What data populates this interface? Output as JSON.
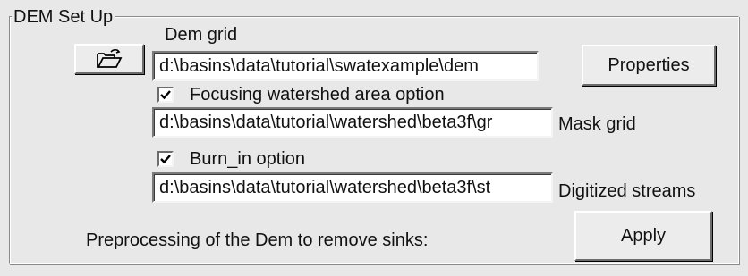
{
  "group": {
    "title": "DEM Set Up"
  },
  "dem": {
    "label": "Dem grid",
    "path": "d:\\basins\\data\\tutorial\\swatexample\\dem",
    "open_icon": "folder-open-icon",
    "properties_label": "Properties"
  },
  "focus": {
    "checked": true,
    "label": "Focusing watershed  area option",
    "path": "d:\\basins\\data\\tutorial\\watershed\\beta3f\\gr",
    "side_label": "Mask grid"
  },
  "burn": {
    "checked": true,
    "label": "Burn_in option",
    "path": "d:\\basins\\data\\tutorial\\watershed\\beta3f\\st",
    "side_label": "Digitized streams"
  },
  "preprocess": {
    "label": "Preprocessing of the Dem to remove sinks:",
    "apply_label": "Apply"
  }
}
